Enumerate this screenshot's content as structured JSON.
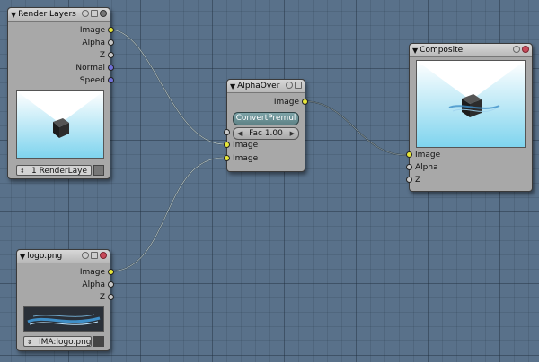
{
  "colors": {
    "background": "#59718a",
    "node_body": "#a8a8a8",
    "socket_image": "#e6e63a",
    "socket_value": "#c8c8c8",
    "socket_vector": "#7070d8",
    "button_accent": "#6e9296"
  },
  "nodes": {
    "render_layers": {
      "title": "Render Layers",
      "outputs": [
        "Image",
        "Alpha",
        "Z",
        "Normal",
        "Speed"
      ],
      "layer_select": "1 RenderLaye"
    },
    "alpha_over": {
      "title": "AlphaOver",
      "output": "Image",
      "convert_button": "ConvertPremul",
      "fac_field": "Fac 1.00",
      "inputs": [
        "Image",
        "Image"
      ]
    },
    "composite": {
      "title": "Composite",
      "inputs": [
        "Image",
        "Alpha",
        "Z"
      ]
    },
    "logo": {
      "title": "logo.png",
      "outputs": [
        "Image",
        "Alpha",
        "Z"
      ],
      "image_select": "IMA:logo.png"
    }
  },
  "icons": {
    "collapse": "triangle-down-icon",
    "node_header_1": "circle-icon",
    "node_header_2": "window-icon",
    "node_header_3": "close-icon"
  }
}
